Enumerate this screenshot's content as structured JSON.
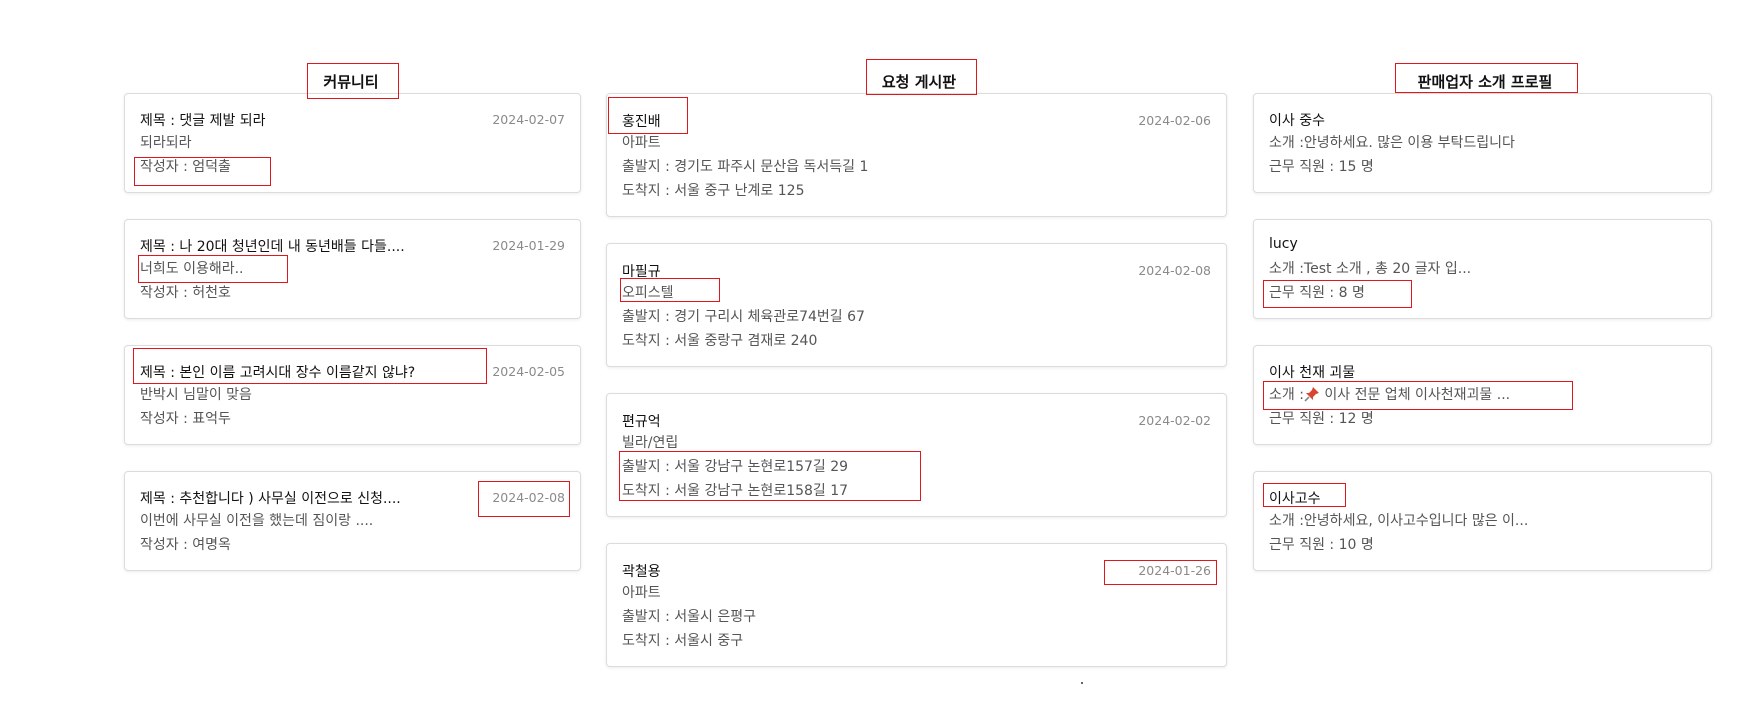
{
  "community": {
    "title": "커뮤니티",
    "posts": [
      {
        "title": "제목 : 댓글 제발 되라",
        "content": "되라되라",
        "author": "작성자 : 엄덕출",
        "date": "2024-02-07"
      },
      {
        "title": "제목 : 나 20대 청년인데 내 동년배들 다들....",
        "content": "너희도 이용해라..",
        "author": "작성자 : 허천호",
        "date": "2024-01-29"
      },
      {
        "title": "제목 : 본인 이름 고려시대 장수 이름같지 않냐?",
        "content": "반박시 님말이 맞음",
        "author": "작성자 : 표억두",
        "date": "2024-02-05"
      },
      {
        "title": "제목 : 추천합니다 ) 사무실 이전으로 신청....",
        "content": "이번에 사무실 이전을 했는데 짐이랑 ....",
        "author": "작성자 : 여명옥",
        "date": "2024-02-08"
      }
    ]
  },
  "requests": {
    "title": "요청 게시판",
    "posts": [
      {
        "name": "홍진배",
        "type": "아파트",
        "from": "출발지 : 경기도 파주시 문산읍 독서득길 1",
        "to": "도착지 : 서울 중구 난계로 125",
        "date": "2024-02-06"
      },
      {
        "name": "마필규",
        "type": "오피스텔",
        "from": "출발지 : 경기 구리시 체육관로74번길 67",
        "to": "도착지 : 서울 중랑구 겸재로 240",
        "date": "2024-02-08"
      },
      {
        "name": "편규억",
        "type": "빌라/연립",
        "from": "출발지 : 서울 강남구 논현로157길 29",
        "to": "도착지 : 서울 강남구 논현로158길 17",
        "date": "2024-02-02"
      },
      {
        "name": "곽철용",
        "type": "아파트",
        "from": "출발지 : 서울시 은평구",
        "to": "도착지 : 서울시 중구",
        "date": "2024-01-26"
      }
    ]
  },
  "sellers": {
    "title": "판매업자 소개 프로필",
    "items": [
      {
        "name": "이사 중수",
        "intro": "소개 :안녕하세요. 많은 이용 부탁드립니다",
        "staff": "근무 직원 : 15 명"
      },
      {
        "name": "lucy",
        "intro": "소개 :Test 소개 , 총 20 글자 입...",
        "staff": "근무 직원 : 8 명"
      },
      {
        "name": "이사 천재 괴물",
        "intro_prefix": "소개 :",
        "intro_icon": "pushpin-icon",
        "intro_rest": " 이사 전문 업체 이사천재괴물 ...",
        "staff": "근무 직원 : 12 명"
      },
      {
        "name": "이사고수",
        "intro": "소개 :안녕하세요, 이사고수입니다 많은 이...",
        "staff": "근무 직원 : 10 명"
      }
    ]
  },
  "colors": {
    "highlight": "#e0181e",
    "date": "#8a8a8a",
    "border": "#dcdcdc"
  }
}
